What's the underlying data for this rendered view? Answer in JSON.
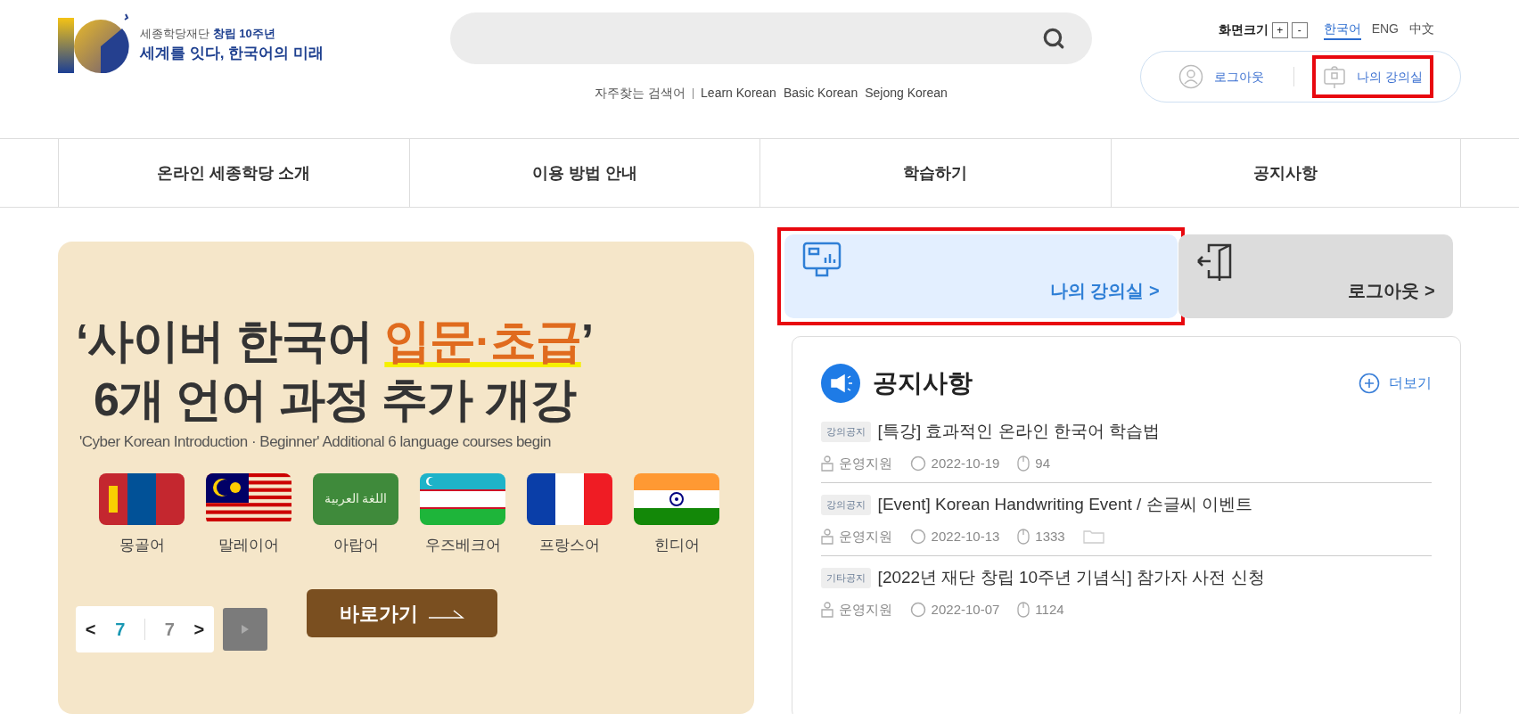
{
  "header": {
    "org_line": "세종학당재단 **창립 10주년**",
    "slogan": "세계를 잇다, 한국어의 미래",
    "search": {
      "trending_label": "자주찾는 검색어",
      "trending_terms": [
        "Learn Korean",
        "Basic Korean",
        "Sejong Korean"
      ]
    },
    "font_size": {
      "label": "화면크기",
      "buttons": [
        "+",
        "-"
      ]
    },
    "languages": [
      {
        "label": "한국어",
        "selected": true
      },
      {
        "label": "ENG",
        "selected": false
      },
      {
        "label": "中文",
        "selected": false
      }
    ],
    "user_links": [
      {
        "label": "로그아웃",
        "kind": "person",
        "highlighted": false
      },
      {
        "label": "나의 강의실",
        "kind": "classroom",
        "highlighted": true
      }
    ]
  },
  "nav": [
    {
      "label": "온라인 세종학당 소개"
    },
    {
      "label": "이용 방법 안내"
    },
    {
      "label": "학습하기"
    },
    {
      "label": "공지사항"
    }
  ],
  "banner": {
    "title_lead": "‘사이버 한국어 ",
    "title_highlight": "입문·초급",
    "title_tail": "’",
    "title_line2": "6개 언어 과정 추가 개강",
    "subtitle": "'Cyber Korean Introduction · Beginner' Additional 6 language courses begin",
    "languages": [
      {
        "label": "몽골어",
        "kind": "mongolia"
      },
      {
        "label": "말레이어",
        "kind": "malaysia"
      },
      {
        "label": "아랍어",
        "kind": "arabic",
        "flag_text": "اللغة العربية"
      },
      {
        "label": "우즈베크어",
        "kind": "uzbekistan"
      },
      {
        "label": "프랑스어",
        "kind": "france"
      },
      {
        "label": "힌디어",
        "kind": "india"
      }
    ],
    "go_button": "바로가기",
    "pager": {
      "prev": "<",
      "current": "7",
      "total": "7",
      "next": ">"
    }
  },
  "quick_links": [
    {
      "label": "나의 강의실 >",
      "kind": "classroom",
      "highlighted": true
    },
    {
      "label": "로그아웃 >",
      "kind": "logout",
      "highlighted": false
    }
  ],
  "notices": {
    "title": "공지사항",
    "more": "더보기",
    "items": [
      {
        "tag": "강의공지",
        "title": "[특강] 효과적인 온라인 한국어 학습법",
        "author": "운영지원",
        "date": "2022-10-19",
        "views": "94",
        "attachment": false
      },
      {
        "tag": "강의공지",
        "title": "[Event] Korean Handwriting Event / 손글씨 이벤트",
        "author": "운영지원",
        "date": "2022-10-13",
        "views": "1333",
        "attachment": true
      },
      {
        "tag": "기타공지",
        "title": "[2022년 재단 창립 10주년 기념식] 참가자 사전 신청",
        "author": "운영지원",
        "date": "2022-10-07",
        "views": "1124",
        "attachment": false
      }
    ]
  }
}
